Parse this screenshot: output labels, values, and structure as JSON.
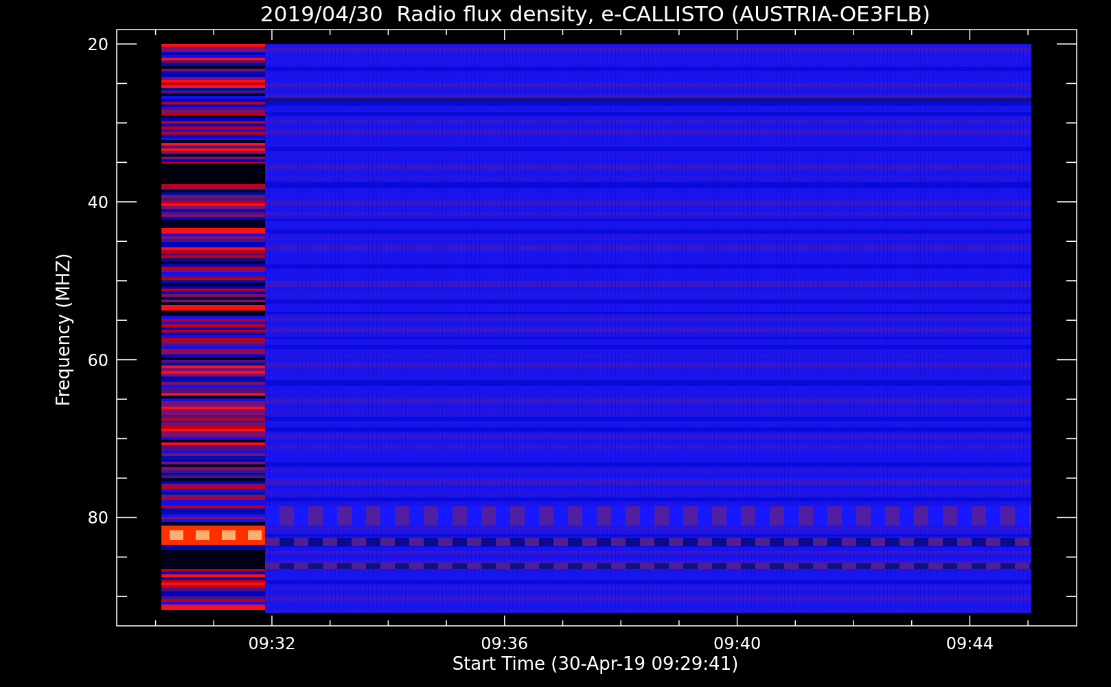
{
  "title": "2019/04/30  Radio flux density, e-CALLISTO (AUSTRIA-OE3FLB)",
  "y_axis": {
    "label": "Frequency (MHZ)",
    "ticks": [
      "20",
      "40",
      "60",
      "80"
    ]
  },
  "x_axis": {
    "label": "Start Time (30-Apr-19 09:29:41)",
    "ticks": [
      "09:32",
      "09:36",
      "09:40",
      "09:44"
    ]
  }
}
